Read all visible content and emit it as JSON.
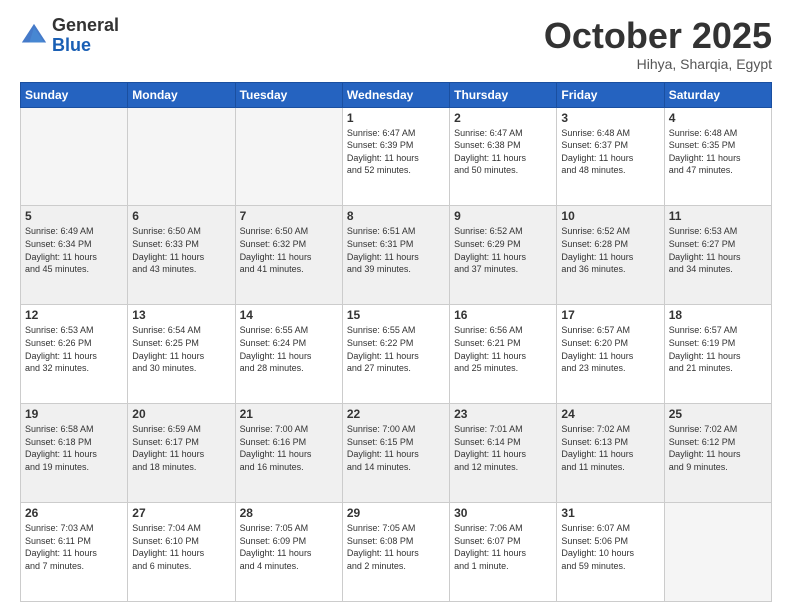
{
  "header": {
    "logo_general": "General",
    "logo_blue": "Blue",
    "month": "October 2025",
    "location": "Hihya, Sharqia, Egypt"
  },
  "days_of_week": [
    "Sunday",
    "Monday",
    "Tuesday",
    "Wednesday",
    "Thursday",
    "Friday",
    "Saturday"
  ],
  "weeks": [
    [
      {
        "day": "",
        "content": ""
      },
      {
        "day": "",
        "content": ""
      },
      {
        "day": "",
        "content": ""
      },
      {
        "day": "1",
        "content": "Sunrise: 6:47 AM\nSunset: 6:39 PM\nDaylight: 11 hours\nand 52 minutes."
      },
      {
        "day": "2",
        "content": "Sunrise: 6:47 AM\nSunset: 6:38 PM\nDaylight: 11 hours\nand 50 minutes."
      },
      {
        "day": "3",
        "content": "Sunrise: 6:48 AM\nSunset: 6:37 PM\nDaylight: 11 hours\nand 48 minutes."
      },
      {
        "day": "4",
        "content": "Sunrise: 6:48 AM\nSunset: 6:35 PM\nDaylight: 11 hours\nand 47 minutes."
      }
    ],
    [
      {
        "day": "5",
        "content": "Sunrise: 6:49 AM\nSunset: 6:34 PM\nDaylight: 11 hours\nand 45 minutes."
      },
      {
        "day": "6",
        "content": "Sunrise: 6:50 AM\nSunset: 6:33 PM\nDaylight: 11 hours\nand 43 minutes."
      },
      {
        "day": "7",
        "content": "Sunrise: 6:50 AM\nSunset: 6:32 PM\nDaylight: 11 hours\nand 41 minutes."
      },
      {
        "day": "8",
        "content": "Sunrise: 6:51 AM\nSunset: 6:31 PM\nDaylight: 11 hours\nand 39 minutes."
      },
      {
        "day": "9",
        "content": "Sunrise: 6:52 AM\nSunset: 6:29 PM\nDaylight: 11 hours\nand 37 minutes."
      },
      {
        "day": "10",
        "content": "Sunrise: 6:52 AM\nSunset: 6:28 PM\nDaylight: 11 hours\nand 36 minutes."
      },
      {
        "day": "11",
        "content": "Sunrise: 6:53 AM\nSunset: 6:27 PM\nDaylight: 11 hours\nand 34 minutes."
      }
    ],
    [
      {
        "day": "12",
        "content": "Sunrise: 6:53 AM\nSunset: 6:26 PM\nDaylight: 11 hours\nand 32 minutes."
      },
      {
        "day": "13",
        "content": "Sunrise: 6:54 AM\nSunset: 6:25 PM\nDaylight: 11 hours\nand 30 minutes."
      },
      {
        "day": "14",
        "content": "Sunrise: 6:55 AM\nSunset: 6:24 PM\nDaylight: 11 hours\nand 28 minutes."
      },
      {
        "day": "15",
        "content": "Sunrise: 6:55 AM\nSunset: 6:22 PM\nDaylight: 11 hours\nand 27 minutes."
      },
      {
        "day": "16",
        "content": "Sunrise: 6:56 AM\nSunset: 6:21 PM\nDaylight: 11 hours\nand 25 minutes."
      },
      {
        "day": "17",
        "content": "Sunrise: 6:57 AM\nSunset: 6:20 PM\nDaylight: 11 hours\nand 23 minutes."
      },
      {
        "day": "18",
        "content": "Sunrise: 6:57 AM\nSunset: 6:19 PM\nDaylight: 11 hours\nand 21 minutes."
      }
    ],
    [
      {
        "day": "19",
        "content": "Sunrise: 6:58 AM\nSunset: 6:18 PM\nDaylight: 11 hours\nand 19 minutes."
      },
      {
        "day": "20",
        "content": "Sunrise: 6:59 AM\nSunset: 6:17 PM\nDaylight: 11 hours\nand 18 minutes."
      },
      {
        "day": "21",
        "content": "Sunrise: 7:00 AM\nSunset: 6:16 PM\nDaylight: 11 hours\nand 16 minutes."
      },
      {
        "day": "22",
        "content": "Sunrise: 7:00 AM\nSunset: 6:15 PM\nDaylight: 11 hours\nand 14 minutes."
      },
      {
        "day": "23",
        "content": "Sunrise: 7:01 AM\nSunset: 6:14 PM\nDaylight: 11 hours\nand 12 minutes."
      },
      {
        "day": "24",
        "content": "Sunrise: 7:02 AM\nSunset: 6:13 PM\nDaylight: 11 hours\nand 11 minutes."
      },
      {
        "day": "25",
        "content": "Sunrise: 7:02 AM\nSunset: 6:12 PM\nDaylight: 11 hours\nand 9 minutes."
      }
    ],
    [
      {
        "day": "26",
        "content": "Sunrise: 7:03 AM\nSunset: 6:11 PM\nDaylight: 11 hours\nand 7 minutes."
      },
      {
        "day": "27",
        "content": "Sunrise: 7:04 AM\nSunset: 6:10 PM\nDaylight: 11 hours\nand 6 minutes."
      },
      {
        "day": "28",
        "content": "Sunrise: 7:05 AM\nSunset: 6:09 PM\nDaylight: 11 hours\nand 4 minutes."
      },
      {
        "day": "29",
        "content": "Sunrise: 7:05 AM\nSunset: 6:08 PM\nDaylight: 11 hours\nand 2 minutes."
      },
      {
        "day": "30",
        "content": "Sunrise: 7:06 AM\nSunset: 6:07 PM\nDaylight: 11 hours\nand 1 minute."
      },
      {
        "day": "31",
        "content": "Sunrise: 6:07 AM\nSunset: 5:06 PM\nDaylight: 10 hours\nand 59 minutes."
      },
      {
        "day": "",
        "content": ""
      }
    ]
  ]
}
